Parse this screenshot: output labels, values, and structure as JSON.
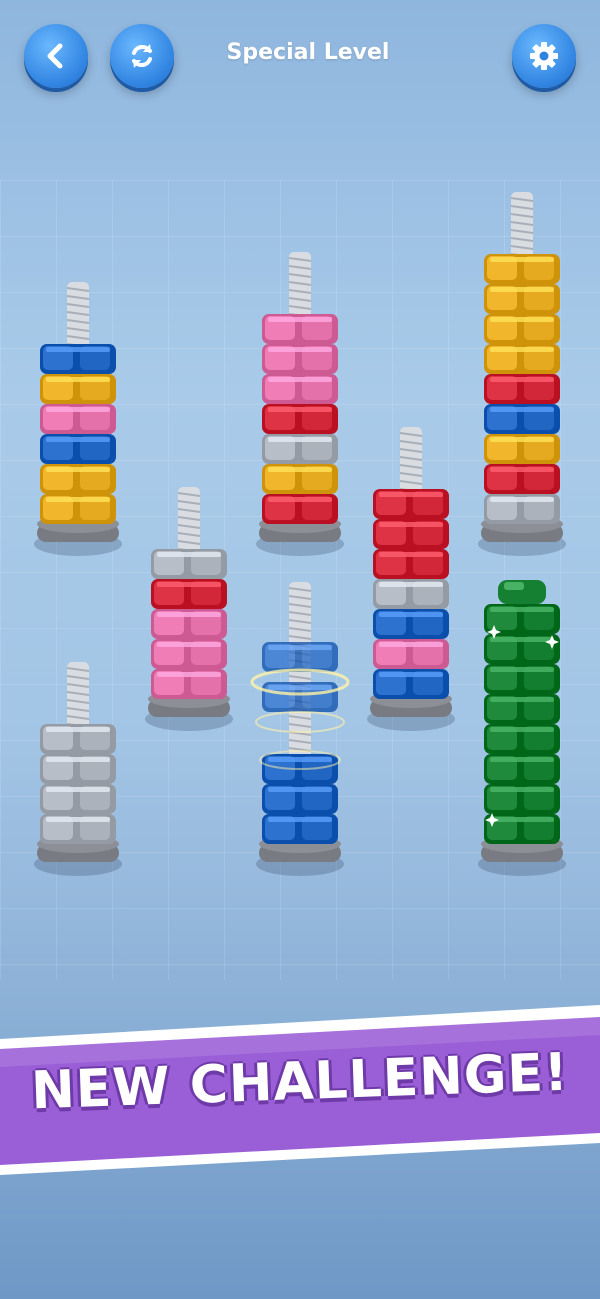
{
  "header": {
    "title": "Special Level",
    "back_icon": "chevron-left-icon",
    "restart_icon": "restart-icon",
    "settings_icon": "gear-icon"
  },
  "banner": {
    "text": "NEW CHALLENGE!",
    "color": "#9a5ed6"
  },
  "colors": {
    "blue": "#2e72cf",
    "yellow": "#f1b62c",
    "pink": "#f07db5",
    "red": "#dd3344",
    "gray": "#b8bec7",
    "green": "#1f8a3c",
    "bolt": "#d9dde2",
    "base": "#8c8f95"
  },
  "bolts": [
    {
      "id": "bolt-1",
      "nuts": [
        "yellow",
        "yellow",
        "blue",
        "pink",
        "yellow",
        "blue"
      ]
    },
    {
      "id": "bolt-2",
      "nuts": [
        "red",
        "yellow",
        "gray",
        "red",
        "pink",
        "pink",
        "pink"
      ]
    },
    {
      "id": "bolt-3",
      "nuts": [
        "gray",
        "red",
        "yellow",
        "blue",
        "red",
        "yellow",
        "yellow",
        "yellow",
        "yellow"
      ]
    },
    {
      "id": "bolt-4",
      "nuts": [
        "pink",
        "pink",
        "pink",
        "red",
        "gray"
      ]
    },
    {
      "id": "bolt-5",
      "nuts": [
        "blue",
        "blue",
        "blue"
      ],
      "lifted": [
        "blue",
        "blue"
      ],
      "spinning": true
    },
    {
      "id": "bolt-6",
      "nuts": [
        "blue",
        "pink",
        "blue",
        "gray",
        "red",
        "red",
        "red"
      ]
    },
    {
      "id": "bolt-7",
      "nuts": [
        "gray",
        "gray",
        "gray",
        "gray"
      ]
    },
    {
      "id": "bolt-8",
      "nuts": [
        "green",
        "green",
        "green",
        "green",
        "green",
        "green",
        "green",
        "green"
      ],
      "capped": true
    }
  ]
}
